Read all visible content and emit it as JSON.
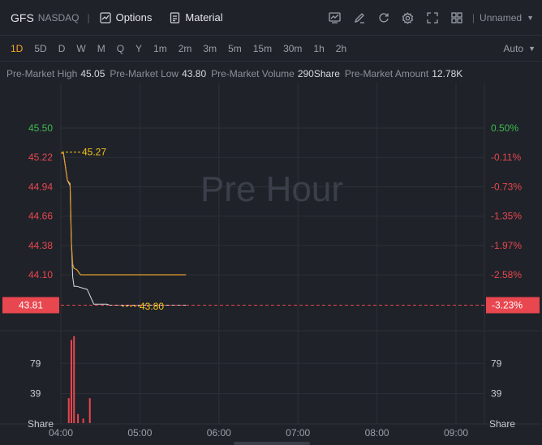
{
  "header": {
    "ticker": "GFS",
    "exchange": "NASDAQ",
    "separator": "|",
    "options_label": "Options",
    "material_label": "Material",
    "layout_label": "Unnamed"
  },
  "intervals": {
    "items": [
      "1D",
      "5D",
      "D",
      "W",
      "M",
      "Q",
      "Y",
      "1m",
      "2m",
      "3m",
      "5m",
      "15m",
      "30m",
      "1h",
      "2h"
    ],
    "active": "1D",
    "auto_label": "Auto"
  },
  "stats": {
    "high_label": "Pre-Market High",
    "high_value": "45.05",
    "low_label": "Pre-Market Low",
    "low_value": "43.80",
    "volume_label": "Pre-Market Volume",
    "volume_value": "290Share",
    "amount_label": "Pre-Market Amount",
    "amount_value": "12.78K"
  },
  "colors": {
    "up": "#3fb950",
    "down": "#e8474f",
    "price_line": "#e39a2d",
    "avg_line": "#d8dbe0",
    "marker": "#f5c518",
    "grid": "#2c3038"
  },
  "chart_data": {
    "type": "line",
    "watermark": "Pre Hour",
    "x_ticks": [
      "04:00",
      "05:00",
      "06:00",
      "07:00",
      "08:00",
      "09:00"
    ],
    "price_ticks": [
      "45.50",
      "45.22",
      "44.94",
      "44.66",
      "44.38",
      "44.10"
    ],
    "price_tick_values": [
      45.5,
      45.22,
      44.94,
      44.66,
      44.38,
      44.1
    ],
    "pct_ticks": [
      "0.50%",
      "-0.11%",
      "-0.73%",
      "-1.35%",
      "-1.97%",
      "-2.58%"
    ],
    "current_price": "43.81",
    "current_pct": "-3.23%",
    "high_marker": "45.27",
    "low_marker": "43.80",
    "ylim": [
      43.66,
      45.76
    ],
    "series": [
      {
        "x": [
          "04:00",
          "04:02",
          "04:05",
          "04:07",
          "04:08",
          "04:09",
          "04:10",
          "04:12",
          "04:15",
          "04:20",
          "05:00",
          "05:35"
        ],
        "values": [
          45.26,
          45.26,
          45.0,
          44.97,
          44.4,
          44.2,
          44.16,
          44.15,
          44.1,
          44.1,
          44.1,
          44.1
        ]
      },
      {
        "x": [
          "04:00",
          "04:02",
          "04:05",
          "04:07",
          "04:08",
          "04:09",
          "04:10",
          "04:12",
          "04:20",
          "04:25",
          "04:35",
          "04:37",
          "05:00",
          "05:35"
        ],
        "values": [
          45.26,
          45.26,
          45.0,
          44.95,
          44.4,
          44.08,
          43.99,
          43.99,
          43.96,
          43.82,
          43.82,
          43.81,
          43.81,
          43.81
        ]
      }
    ],
    "volume": {
      "label": "Share",
      "ticks": [
        "79",
        "39"
      ],
      "tick_values": [
        79,
        39
      ],
      "ymax": 120,
      "x": [
        "04:06",
        "04:08",
        "04:10",
        "04:13",
        "04:17",
        "04:22"
      ],
      "values": [
        33,
        110,
        115,
        12,
        6,
        33
      ]
    }
  }
}
